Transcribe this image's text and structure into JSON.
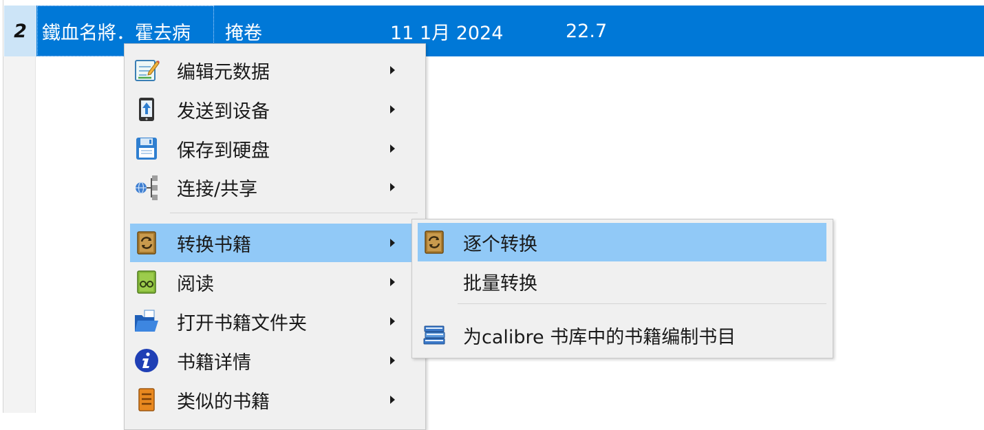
{
  "book_row": {
    "number": "2",
    "title": "鐵血名將．霍去病",
    "author": "掩卷",
    "date": "11 1月 2024",
    "size": "22.7"
  },
  "context_menu": {
    "items": [
      {
        "label": "编辑元数据",
        "icon": "edit-metadata-icon"
      },
      {
        "label": "发送到设备",
        "icon": "send-to-device-icon"
      },
      {
        "label": "保存到硬盘",
        "icon": "save-to-disk-icon"
      },
      {
        "label": "连接/共享",
        "icon": "connect-share-icon"
      },
      {
        "label": "转换书籍",
        "icon": "convert-books-icon"
      },
      {
        "label": "阅读",
        "icon": "read-book-icon"
      },
      {
        "label": "打开书籍文件夹",
        "icon": "open-folder-icon"
      },
      {
        "label": "书籍详情",
        "icon": "info-icon"
      },
      {
        "label": "类似的书籍",
        "icon": "similar-books-icon"
      }
    ]
  },
  "submenu": {
    "items": [
      {
        "label": "逐个转换",
        "icon": "convert-books-icon"
      },
      {
        "label": "批量转换",
        "icon": ""
      },
      {
        "label": "为calibre 书库中的书籍编制书目",
        "icon": "catalog-icon"
      }
    ]
  },
  "colors": {
    "selection": "#0078d7",
    "menu_highlight": "#91c9f7",
    "menu_background": "#f0f0f0"
  }
}
